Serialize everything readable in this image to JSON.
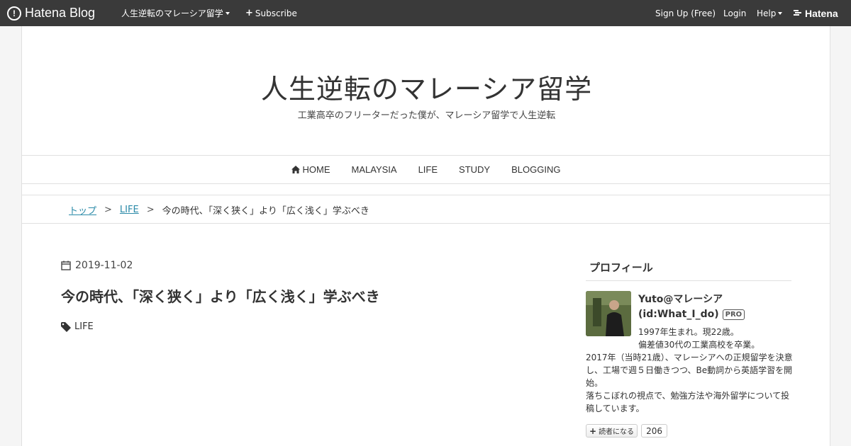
{
  "topbar": {
    "logo_text": "Hatena Blog",
    "blog_menu": "人生逆転のマレーシア留学",
    "subscribe": "Subscribe",
    "signup": "Sign Up (Free)",
    "login": "Login",
    "help": "Help",
    "brand": "Hatena"
  },
  "header": {
    "title": "人生逆転のマレーシア留学",
    "description": "工業高卒のフリーターだった僕が、マレーシア留学で人生逆転"
  },
  "nav": {
    "items": [
      "HOME",
      "MALAYSIA",
      "LIFE",
      "STUDY",
      "BLOGGING"
    ]
  },
  "breadcrumb": {
    "top": "トップ",
    "category": "LIFE",
    "sep": ">",
    "current": "今の時代、「深く狭く」より「広く浅く」学ぶべき"
  },
  "entry": {
    "date": "2019-11-02",
    "title": "今の時代、「深く狭く」より「広く浅く」学ぶべき",
    "category": "LIFE"
  },
  "sidebar": {
    "title": "プロフィール",
    "name": "Yuto@マレーシア",
    "id": "(id:What_I_do)",
    "pro": "PRO",
    "desc_line1": "1997年生まれ。現22歳。",
    "desc_line2": "偏差値30代の工業高校を卒業。",
    "desc_long": "2017年（当時21歳）、マレーシアへの正規留学を決意し、工場で週５日働きつつ、Be動詞から英語学習を開始。",
    "desc_long2": "落ちこぼれの視点で、勉強方法や海外留学について投稿しています。",
    "subscribe_label": "読者になる",
    "subscriber_count": "206"
  },
  "colors": {
    "topbar": "#3a3a3a",
    "link": "#2a8aa8"
  }
}
